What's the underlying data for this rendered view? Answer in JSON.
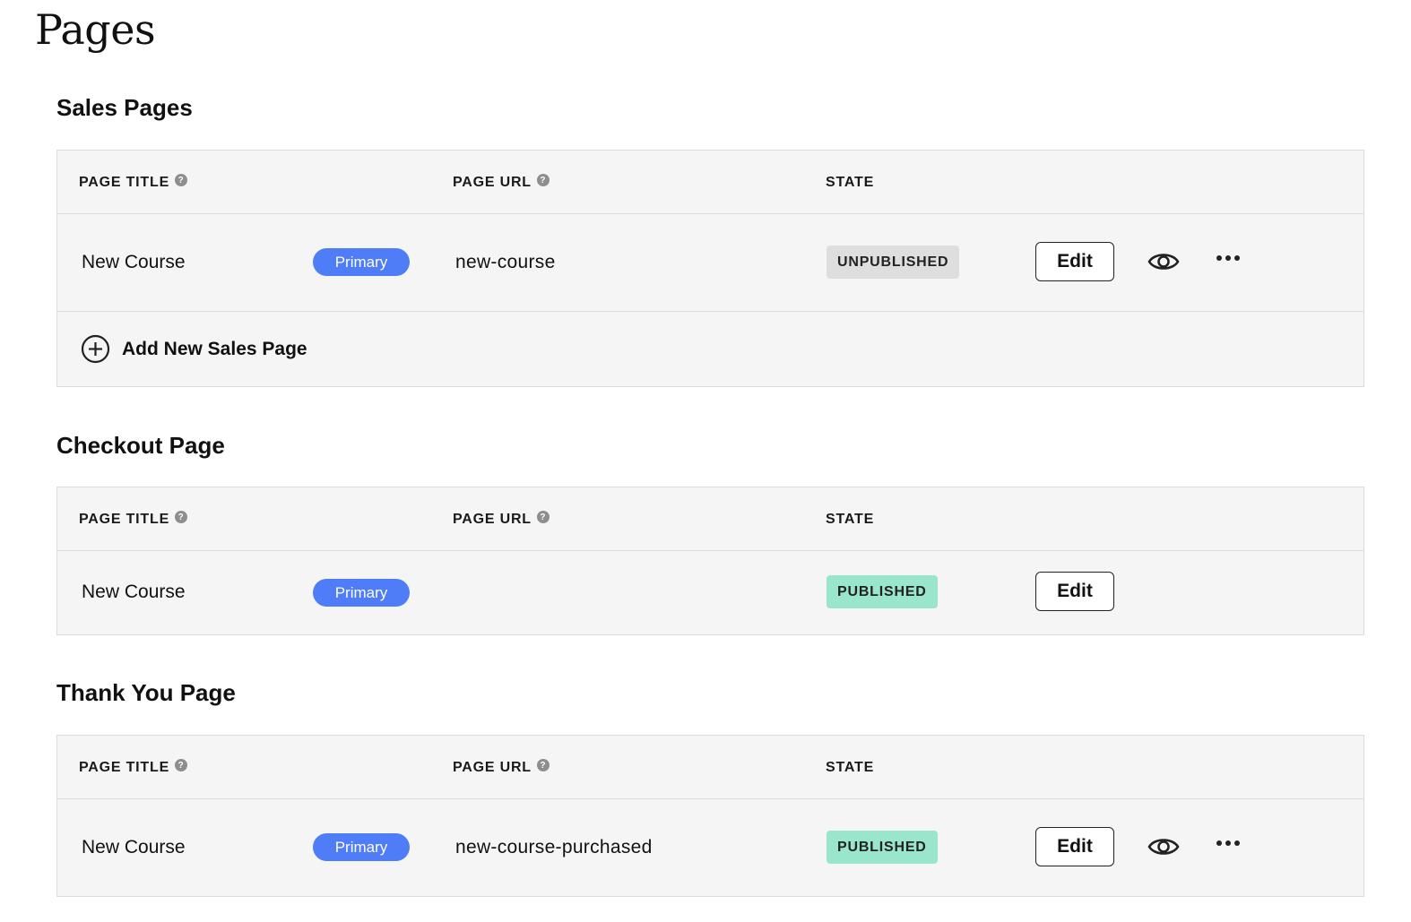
{
  "page": {
    "title": "Pages"
  },
  "headers": {
    "page_title": "PAGE TITLE",
    "page_url": "PAGE URL",
    "state": "STATE"
  },
  "sections": {
    "sales": {
      "title": "Sales Pages",
      "rows": [
        {
          "page_title": "New Course",
          "badge": "Primary",
          "url": "new-course",
          "state": "UNPUBLISHED",
          "edit_label": "Edit"
        }
      ],
      "add_label": "Add New Sales Page"
    },
    "checkout": {
      "title": "Checkout Page",
      "rows": [
        {
          "page_title": "New Course",
          "badge": "Primary",
          "url": "",
          "state": "PUBLISHED",
          "edit_label": "Edit"
        }
      ]
    },
    "thankyou": {
      "title": "Thank You Page",
      "rows": [
        {
          "page_title": "New Course",
          "badge": "Primary",
          "url": "new-course-purchased",
          "state": "PUBLISHED",
          "edit_label": "Edit"
        }
      ]
    }
  },
  "icons": {
    "help": "question-circle-icon",
    "preview": "eye-icon",
    "more": "ellipsis-icon",
    "add": "plus-circle-icon"
  },
  "colors": {
    "primary_badge": "#4f7cf7",
    "published": "#9ae6cc",
    "unpublished": "#dedede"
  }
}
